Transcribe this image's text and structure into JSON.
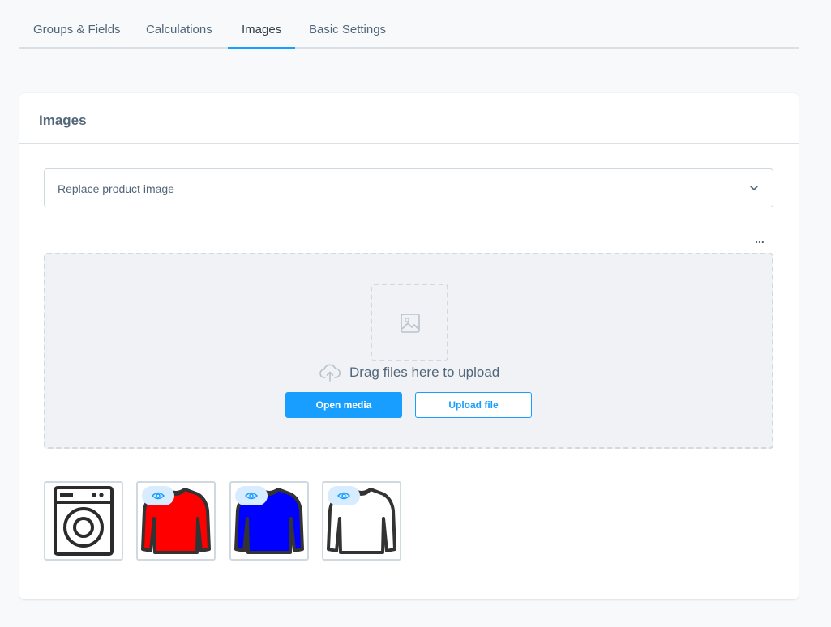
{
  "tabs": [
    {
      "label": "Groups & Fields",
      "active": false
    },
    {
      "label": "Calculations",
      "active": false
    },
    {
      "label": "Images",
      "active": true
    },
    {
      "label": "Basic Settings",
      "active": false
    }
  ],
  "card": {
    "title": "Images",
    "select": {
      "value": "Replace product image"
    },
    "more_label": "...",
    "dropzone": {
      "drag_text": "Drag files here to upload",
      "open_media_label": "Open media",
      "upload_file_label": "Upload file"
    },
    "thumbnails": [
      {
        "name": "washing-machine",
        "color": "#ffffff",
        "has_eye": false
      },
      {
        "name": "red-longsleeve",
        "color": "#ff0000",
        "has_eye": true
      },
      {
        "name": "blue-longsleeve",
        "color": "#0000ff",
        "has_eye": true
      },
      {
        "name": "white-longsleeve",
        "color": "#ffffff",
        "has_eye": true
      }
    ]
  },
  "colors": {
    "accent": "#189eff",
    "text": "#52667a",
    "border": "#d1d9e0"
  }
}
